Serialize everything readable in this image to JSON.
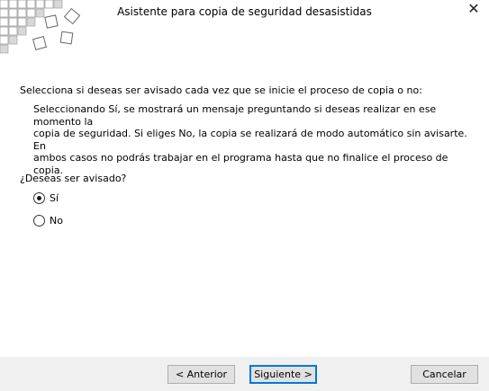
{
  "window": {
    "title": "Asistente para copia de seguridad desasistidas",
    "close_icon": "close-icon"
  },
  "main": {
    "question": "Selecciona si deseas ser avisado cada vez que se inicie el proceso de copia o no:",
    "description_lines": [
      "Seleccionando Sí, se mostrará un mensaje preguntando si deseas realizar en ese momento la",
      "copia de seguridad. Si eliges No, la copia se realizará de modo automático sin avisarte. En",
      "ambos casos no podrás trabajar en el programa hasta que no finalice el proceso de copia."
    ],
    "ask_label": "¿Deseas ser avisado?",
    "options": [
      {
        "label": "Sí",
        "checked": true
      },
      {
        "label": "No",
        "checked": false
      }
    ]
  },
  "footer": {
    "back_label": "< Anterior",
    "next_label": "Siguiente >",
    "cancel_label": "Cancelar"
  }
}
